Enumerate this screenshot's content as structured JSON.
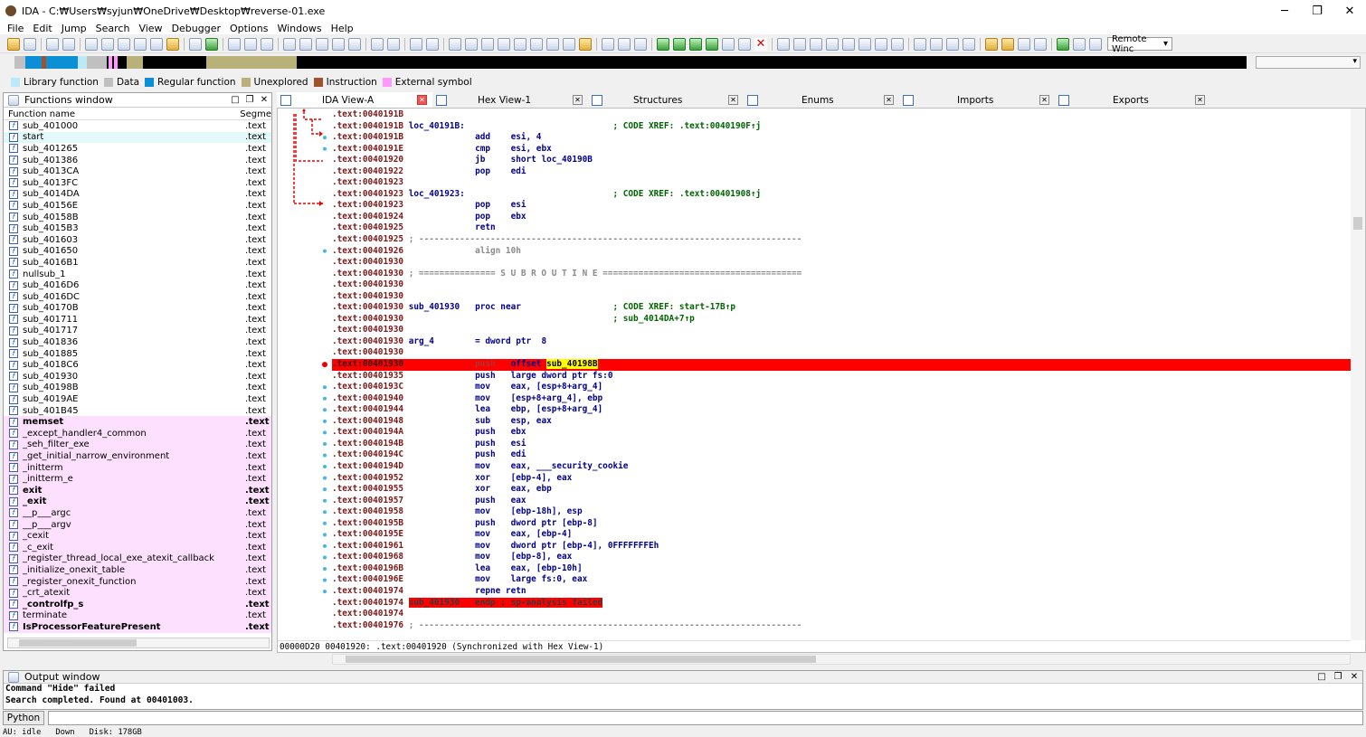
{
  "window": {
    "title": "IDA - C:₩Users₩syjun₩OneDrive₩Desktop₩reverse-01.exe",
    "controls": [
      "─",
      "❐",
      "✕"
    ]
  },
  "menu": [
    "File",
    "Edit",
    "Jump",
    "Search",
    "View",
    "Debugger",
    "Options",
    "Windows",
    "Help"
  ],
  "toolbar": {
    "remote_debugger": "Remote Winc"
  },
  "legend": [
    {
      "label": "Library function",
      "color": "#bde8f5"
    },
    {
      "label": "Data",
      "color": "#c0c0c0"
    },
    {
      "label": "Regular function",
      "color": "#0d8fd6"
    },
    {
      "label": "Unexplored",
      "color": "#b8b27a"
    },
    {
      "label": "Instruction",
      "color": "#a0522d"
    },
    {
      "label": "External symbol",
      "color": "#ff99ff"
    }
  ],
  "functions_window": {
    "title": "Functions window",
    "columns": [
      "Function name",
      "Segme"
    ],
    "rows": [
      {
        "name": "sub_401000",
        "seg": ".text",
        "kind": "regular"
      },
      {
        "name": "start",
        "seg": ".text",
        "kind": "selected"
      },
      {
        "name": "sub_401265",
        "seg": ".text",
        "kind": "regular"
      },
      {
        "name": "sub_401386",
        "seg": ".text",
        "kind": "regular"
      },
      {
        "name": "sub_4013CA",
        "seg": ".text",
        "kind": "regular"
      },
      {
        "name": "sub_4013FC",
        "seg": ".text",
        "kind": "regular"
      },
      {
        "name": "sub_4014DA",
        "seg": ".text",
        "kind": "regular"
      },
      {
        "name": "sub_40156E",
        "seg": ".text",
        "kind": "regular"
      },
      {
        "name": "sub_40158B",
        "seg": ".text",
        "kind": "regular"
      },
      {
        "name": "sub_4015B3",
        "seg": ".text",
        "kind": "regular"
      },
      {
        "name": "sub_401603",
        "seg": ".text",
        "kind": "regular"
      },
      {
        "name": "sub_401650",
        "seg": ".text",
        "kind": "regular"
      },
      {
        "name": "sub_4016B1",
        "seg": ".text",
        "kind": "regular"
      },
      {
        "name": "nullsub_1",
        "seg": ".text",
        "kind": "regular"
      },
      {
        "name": "sub_4016D6",
        "seg": ".text",
        "kind": "regular"
      },
      {
        "name": "sub_4016DC",
        "seg": ".text",
        "kind": "regular"
      },
      {
        "name": "sub_40170B",
        "seg": ".text",
        "kind": "regular"
      },
      {
        "name": "sub_401711",
        "seg": ".text",
        "kind": "regular"
      },
      {
        "name": "sub_401717",
        "seg": ".text",
        "kind": "regular"
      },
      {
        "name": "sub_401836",
        "seg": ".text",
        "kind": "regular"
      },
      {
        "name": "sub_401885",
        "seg": ".text",
        "kind": "regular"
      },
      {
        "name": "sub_4018C6",
        "seg": ".text",
        "kind": "regular"
      },
      {
        "name": "sub_401930",
        "seg": ".text",
        "kind": "regular"
      },
      {
        "name": "sub_40198B",
        "seg": ".text",
        "kind": "regular"
      },
      {
        "name": "sub_4019AE",
        "seg": ".text",
        "kind": "regular"
      },
      {
        "name": "sub_401B45",
        "seg": ".text",
        "kind": "regular"
      },
      {
        "name": "memset",
        "seg": ".text",
        "kind": "lib-bold"
      },
      {
        "name": "_except_handler4_common",
        "seg": ".text",
        "kind": "lib"
      },
      {
        "name": "_seh_filter_exe",
        "seg": ".text",
        "kind": "lib"
      },
      {
        "name": "_get_initial_narrow_environment",
        "seg": ".text",
        "kind": "lib"
      },
      {
        "name": "_initterm",
        "seg": ".text",
        "kind": "lib"
      },
      {
        "name": "_initterm_e",
        "seg": ".text",
        "kind": "lib"
      },
      {
        "name": "exit",
        "seg": ".text",
        "kind": "lib-bold"
      },
      {
        "name": "_exit",
        "seg": ".text",
        "kind": "lib-bold"
      },
      {
        "name": "__p___argc",
        "seg": ".text",
        "kind": "lib"
      },
      {
        "name": "__p___argv",
        "seg": ".text",
        "kind": "lib"
      },
      {
        "name": "_cexit",
        "seg": ".text",
        "kind": "lib"
      },
      {
        "name": "_c_exit",
        "seg": ".text",
        "kind": "lib"
      },
      {
        "name": "_register_thread_local_exe_atexit_callback",
        "seg": ".text",
        "kind": "lib"
      },
      {
        "name": "_initialize_onexit_table",
        "seg": ".text",
        "kind": "lib"
      },
      {
        "name": "_register_onexit_function",
        "seg": ".text",
        "kind": "lib"
      },
      {
        "name": "_crt_atexit",
        "seg": ".text",
        "kind": "lib"
      },
      {
        "name": "_controlfp_s",
        "seg": ".text",
        "kind": "lib-bold"
      },
      {
        "name": "terminate",
        "seg": ".text",
        "kind": "lib"
      },
      {
        "name": "IsProcessorFeaturePresent",
        "seg": ".text",
        "kind": "lib-bold"
      }
    ]
  },
  "tabs": [
    {
      "label": "IDA View-A",
      "active": true
    },
    {
      "label": "Hex View-1",
      "active": false
    },
    {
      "label": "Structures",
      "active": false
    },
    {
      "label": "Enums",
      "active": false
    },
    {
      "label": "Imports",
      "active": false
    },
    {
      "label": "Exports",
      "active": false
    }
  ],
  "disasm": [
    {
      "addr": ".text:0040191B",
      "label": "",
      "mnem": "",
      "ops": "",
      "cmt": ""
    },
    {
      "addr": ".text:0040191B",
      "label": "loc_40191B:",
      "mnem": "",
      "ops": "",
      "cmt": "; CODE XREF: .text:0040190F↑j"
    },
    {
      "addr": ".text:0040191B",
      "label": "",
      "mnem": "add",
      "ops": "esi, 4",
      "cmt": ""
    },
    {
      "addr": ".text:0040191E",
      "label": "",
      "mnem": "cmp",
      "ops": "esi, ebx",
      "cmt": ""
    },
    {
      "addr": ".text:00401920",
      "label": "",
      "mnem": "jb",
      "ops": "short loc_40190B",
      "cmt": ""
    },
    {
      "addr": ".text:00401922",
      "label": "",
      "mnem": "pop",
      "ops": "edi",
      "cmt": ""
    },
    {
      "addr": ".text:00401923",
      "label": "",
      "mnem": "",
      "ops": "",
      "cmt": ""
    },
    {
      "addr": ".text:00401923",
      "label": "loc_401923:",
      "mnem": "",
      "ops": "",
      "cmt": "; CODE XREF: .text:00401908↑j"
    },
    {
      "addr": ".text:00401923",
      "label": "",
      "mnem": "pop",
      "ops": "esi",
      "cmt": ""
    },
    {
      "addr": ".text:00401924",
      "label": "",
      "mnem": "pop",
      "ops": "ebx",
      "cmt": ""
    },
    {
      "addr": ".text:00401925",
      "label": "",
      "mnem": "retn",
      "ops": "",
      "cmt": ""
    },
    {
      "addr": ".text:00401925",
      "sep": "; ---------------------------------------------------------------------------"
    },
    {
      "addr": ".text:00401926",
      "label": "",
      "mnem": "align 10h",
      "ops": "",
      "cmt": "",
      "gray": true
    },
    {
      "addr": ".text:00401930",
      "label": "",
      "mnem": "",
      "ops": "",
      "cmt": ""
    },
    {
      "addr": ".text:00401930",
      "sep": "; =============== S U B R O U T I N E ======================================="
    },
    {
      "addr": ".text:00401930",
      "label": "",
      "mnem": "",
      "ops": "",
      "cmt": ""
    },
    {
      "addr": ".text:00401930",
      "label": "",
      "mnem": "",
      "ops": "",
      "cmt": ""
    },
    {
      "addr": ".text:00401930",
      "label": "sub_401930",
      "mnem": "proc near",
      "ops": "",
      "cmt": "; CODE XREF: start-17B↑p"
    },
    {
      "addr": ".text:00401930",
      "label": "",
      "mnem": "",
      "ops": "",
      "cmt": "; sub_4014DA+7↑p"
    },
    {
      "addr": ".text:00401930",
      "label": "",
      "mnem": "",
      "ops": "",
      "cmt": ""
    },
    {
      "addr": ".text:00401930",
      "label": "arg_4",
      "mnem": "= dword ptr",
      "ops": " 8",
      "cmt": ""
    },
    {
      "addr": ".text:00401930",
      "label": "",
      "mnem": "",
      "ops": "",
      "cmt": ""
    },
    {
      "addr": ".text:00401930",
      "label": "",
      "mnem": "push",
      "ops": "offset ",
      "sym": "sub_40198B",
      "cmt": "",
      "hl": true
    },
    {
      "addr": ".text:00401935",
      "label": "",
      "mnem": "push",
      "ops": "large dword ptr fs:0",
      "cmt": ""
    },
    {
      "addr": ".text:0040193C",
      "label": "",
      "mnem": "mov",
      "ops": "eax, [esp+8+arg_4]",
      "cmt": ""
    },
    {
      "addr": ".text:00401940",
      "label": "",
      "mnem": "mov",
      "ops": "[esp+8+arg_4], ebp",
      "cmt": ""
    },
    {
      "addr": ".text:00401944",
      "label": "",
      "mnem": "lea",
      "ops": "ebp, [esp+8+arg_4]",
      "cmt": ""
    },
    {
      "addr": ".text:00401948",
      "label": "",
      "mnem": "sub",
      "ops": "esp, eax",
      "cmt": ""
    },
    {
      "addr": ".text:0040194A",
      "label": "",
      "mnem": "push",
      "ops": "ebx",
      "cmt": ""
    },
    {
      "addr": ".text:0040194B",
      "label": "",
      "mnem": "push",
      "ops": "esi",
      "cmt": ""
    },
    {
      "addr": ".text:0040194C",
      "label": "",
      "mnem": "push",
      "ops": "edi",
      "cmt": ""
    },
    {
      "addr": ".text:0040194D",
      "label": "",
      "mnem": "mov",
      "ops": "eax, ___security_cookie",
      "cmt": ""
    },
    {
      "addr": ".text:00401952",
      "label": "",
      "mnem": "xor",
      "ops": "[ebp-4], eax",
      "cmt": ""
    },
    {
      "addr": ".text:00401955",
      "label": "",
      "mnem": "xor",
      "ops": "eax, ebp",
      "cmt": ""
    },
    {
      "addr": ".text:00401957",
      "label": "",
      "mnem": "push",
      "ops": "eax",
      "cmt": ""
    },
    {
      "addr": ".text:00401958",
      "label": "",
      "mnem": "mov",
      "ops": "[ebp-18h], esp",
      "cmt": ""
    },
    {
      "addr": ".text:0040195B",
      "label": "",
      "mnem": "push",
      "ops": "dword ptr [ebp-8]",
      "cmt": ""
    },
    {
      "addr": ".text:0040195E",
      "label": "",
      "mnem": "mov",
      "ops": "eax, [ebp-4]",
      "cmt": ""
    },
    {
      "addr": ".text:00401961",
      "label": "",
      "mnem": "mov",
      "ops": "dword ptr [ebp-4], 0FFFFFFFEh",
      "cmt": ""
    },
    {
      "addr": ".text:00401968",
      "label": "",
      "mnem": "mov",
      "ops": "[ebp-8], eax",
      "cmt": ""
    },
    {
      "addr": ".text:0040196B",
      "label": "",
      "mnem": "lea",
      "ops": "eax, [ebp-10h]",
      "cmt": ""
    },
    {
      "addr": ".text:0040196E",
      "label": "",
      "mnem": "mov",
      "ops": "large fs:0, eax",
      "cmt": ""
    },
    {
      "addr": ".text:00401974",
      "label": "",
      "mnem": "repne retn",
      "ops": "",
      "cmt": ""
    },
    {
      "addr": ".text:00401974",
      "label": "sub_401930",
      "mnem": "endp ; sp-analysis failed",
      "ops": "",
      "cmt": "",
      "err": true
    },
    {
      "addr": ".text:00401974",
      "label": "",
      "mnem": "",
      "ops": "",
      "cmt": ""
    },
    {
      "addr": ".text:00401976",
      "sep": "; ---------------------------------------------------------------------------"
    }
  ],
  "sync_line": "00000D20 00401920: .text:00401920 (Synchronized with Hex View-1)",
  "output_window": {
    "title": "Output window",
    "lines": [
      "Command \"Hide\" failed",
      "Search completed. Found at 00401003."
    ]
  },
  "python_button": "Python",
  "status": [
    "AU:  idle",
    "Down",
    "Disk: 178GB"
  ]
}
